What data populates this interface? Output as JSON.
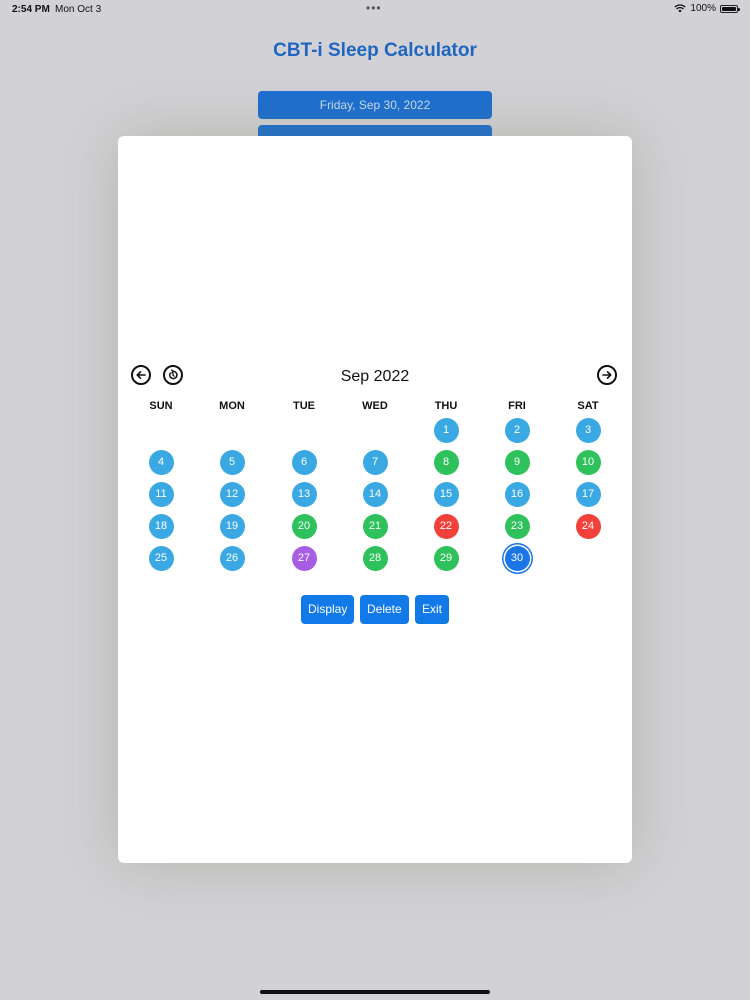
{
  "status_bar": {
    "time": "2:54 PM",
    "date": "Mon Oct 3",
    "dots": "•••",
    "battery": "100%",
    "icons": [
      "wifi-icon",
      "battery-icon"
    ]
  },
  "app": {
    "title": "CBT-i Sleep Calculator",
    "date_button_1": "Friday, Sep 30, 2022",
    "date_button_2": ""
  },
  "calendar": {
    "month_label": "Sep 2022",
    "weekdays": [
      "SUN",
      "MON",
      "TUE",
      "WED",
      "THU",
      "FRI",
      "SAT"
    ],
    "colors": {
      "blue": "#3aa8e3",
      "green": "#2ec15c",
      "red": "#f2403a",
      "purple": "#a75ee3",
      "selected": "#1a76e6"
    },
    "weeks": [
      [
        null,
        null,
        null,
        null,
        {
          "n": "1",
          "c": "blue"
        },
        {
          "n": "2",
          "c": "blue"
        },
        {
          "n": "3",
          "c": "blue"
        }
      ],
      [
        {
          "n": "4",
          "c": "blue"
        },
        {
          "n": "5",
          "c": "blue"
        },
        {
          "n": "6",
          "c": "blue"
        },
        {
          "n": "7",
          "c": "blue"
        },
        {
          "n": "8",
          "c": "green"
        },
        {
          "n": "9",
          "c": "green"
        },
        {
          "n": "10",
          "c": "green"
        }
      ],
      [
        {
          "n": "11",
          "c": "blue"
        },
        {
          "n": "12",
          "c": "blue"
        },
        {
          "n": "13",
          "c": "blue"
        },
        {
          "n": "14",
          "c": "blue"
        },
        {
          "n": "15",
          "c": "blue"
        },
        {
          "n": "16",
          "c": "blue"
        },
        {
          "n": "17",
          "c": "blue"
        }
      ],
      [
        {
          "n": "18",
          "c": "blue"
        },
        {
          "n": "19",
          "c": "blue"
        },
        {
          "n": "20",
          "c": "green"
        },
        {
          "n": "21",
          "c": "green"
        },
        {
          "n": "22",
          "c": "red"
        },
        {
          "n": "23",
          "c": "green"
        },
        {
          "n": "24",
          "c": "red"
        }
      ],
      [
        {
          "n": "25",
          "c": "blue"
        },
        {
          "n": "26",
          "c": "blue"
        },
        {
          "n": "27",
          "c": "purple"
        },
        {
          "n": "28",
          "c": "green"
        },
        {
          "n": "29",
          "c": "green"
        },
        {
          "n": "30",
          "c": "selected"
        },
        null
      ]
    ],
    "selected_day": "30"
  },
  "actions": {
    "display_label": "Display",
    "delete_label": "Delete",
    "exit_label": "Exit"
  }
}
